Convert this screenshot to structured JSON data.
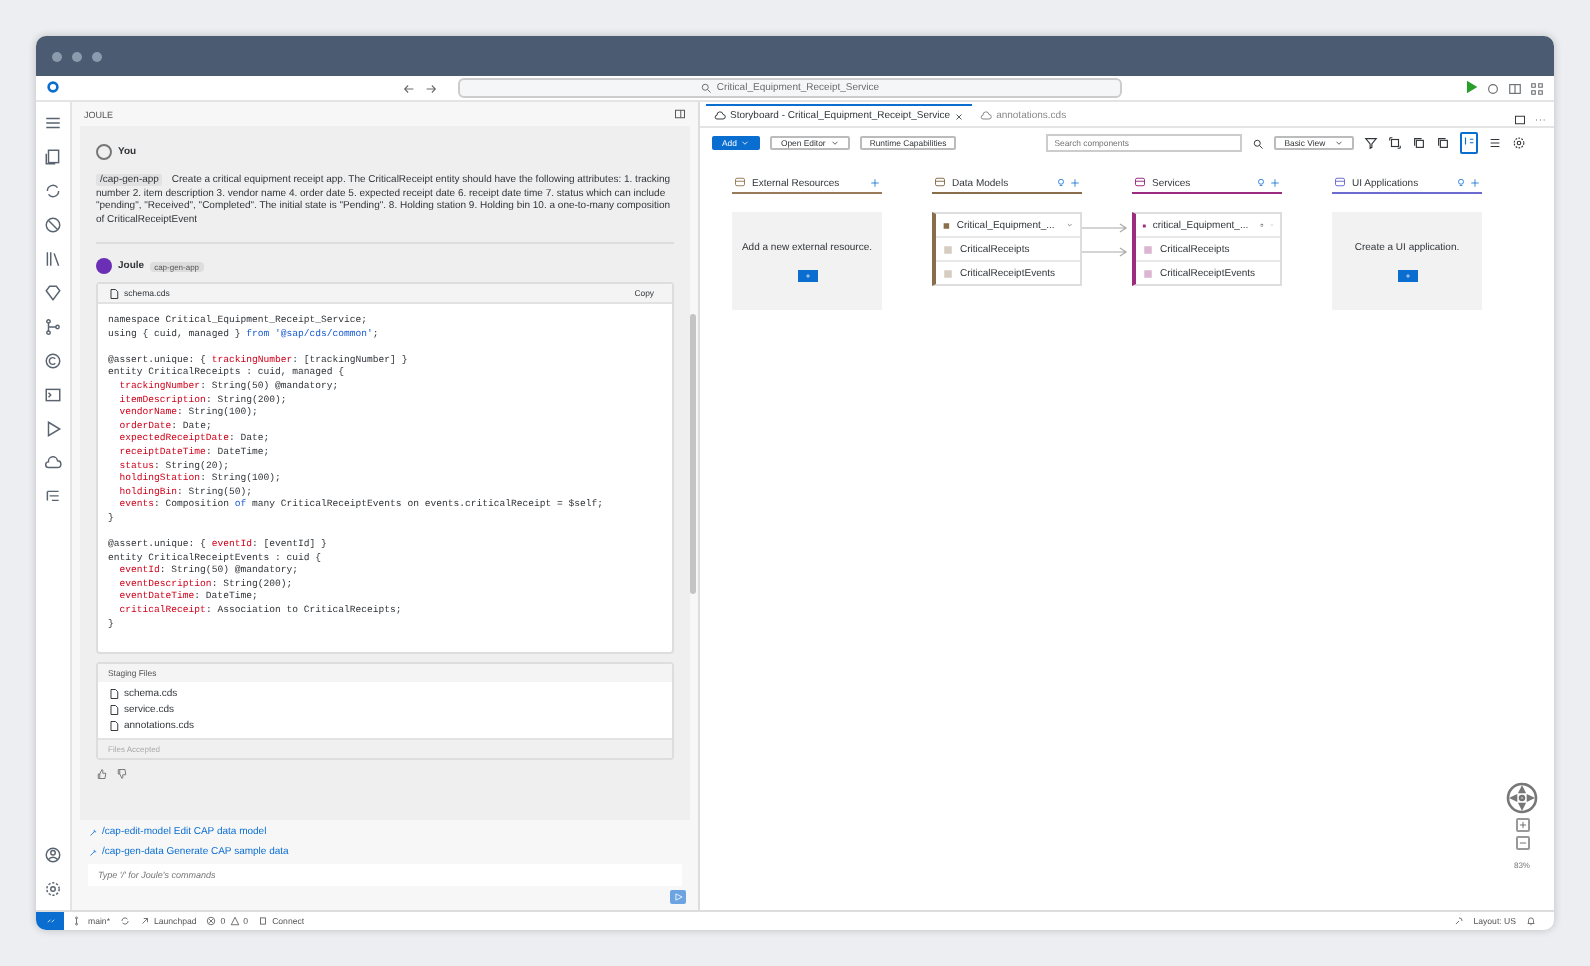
{
  "window": {
    "search": "Critical_Equipment_Receipt_Service"
  },
  "panel": {
    "title": "JOULE"
  },
  "user_message": {
    "name": "You",
    "command": "/cap-gen-app",
    "text": "Create a critical equipment receipt app. The CriticalReceipt entity should have the following attributes: 1. tracking number 2. item description 3. vendor name 4. order date 5. expected receipt date 6. receipt date time 7. status which can include \"pending\", \"Received\", \"Completed\". The initial state is \"Pending\". 8. Holding station 9. Holding bin 10. a one-to-many composition of CriticalReceiptEvent"
  },
  "reply": {
    "name": "Joule",
    "badge": "cap-gen-app",
    "file": "schema.cds",
    "copy": "Copy",
    "code": [
      {
        "indent": false,
        "gap_before": false,
        "parts": [
          {
            "kind": "plain",
            "text": "namespace Critical_Equipment_Receipt_Service;"
          }
        ]
      },
      {
        "indent": false,
        "gap_before": false,
        "parts": [
          {
            "kind": "plain",
            "text": "using { cuid, managed }"
          },
          {
            "kind": "kw",
            "text": "from"
          },
          {
            "kind": "str",
            "text": "'@sap/cds/common'"
          },
          {
            "kind": "punct",
            "text": ";"
          }
        ]
      },
      {
        "indent": false,
        "gap_before": true,
        "parts": [
          {
            "kind": "plain",
            "text": "@assert.unique: {"
          },
          {
            "kind": "key",
            "text": "trackingNumber"
          },
          {
            "kind": "punct",
            "text": ": [trackingNumber] }"
          }
        ]
      },
      {
        "indent": false,
        "gap_before": false,
        "parts": [
          {
            "kind": "plain",
            "text": "entity CriticalReceipts : cuid, managed {"
          }
        ]
      },
      {
        "indent": true,
        "gap_before": false,
        "parts": [
          {
            "kind": "key",
            "text": "trackingNumber"
          },
          {
            "kind": "punct",
            "text": ": String(50) @mandatory;"
          }
        ]
      },
      {
        "indent": true,
        "gap_before": false,
        "parts": [
          {
            "kind": "key",
            "text": "itemDescription"
          },
          {
            "kind": "punct",
            "text": ": String(200);"
          }
        ]
      },
      {
        "indent": true,
        "gap_before": false,
        "parts": [
          {
            "kind": "key",
            "text": "vendorName"
          },
          {
            "kind": "punct",
            "text": ": String(100);"
          }
        ]
      },
      {
        "indent": true,
        "gap_before": false,
        "parts": [
          {
            "kind": "key",
            "text": "orderDate"
          },
          {
            "kind": "punct",
            "text": ": Date;"
          }
        ]
      },
      {
        "indent": true,
        "gap_before": false,
        "parts": [
          {
            "kind": "key",
            "text": "expectedReceiptDate"
          },
          {
            "kind": "punct",
            "text": ": Date;"
          }
        ]
      },
      {
        "indent": true,
        "gap_before": false,
        "parts": [
          {
            "kind": "key",
            "text": "receiptDateTime"
          },
          {
            "kind": "punct",
            "text": ": DateTime;"
          }
        ]
      },
      {
        "indent": true,
        "gap_before": false,
        "parts": [
          {
            "kind": "key",
            "text": "status"
          },
          {
            "kind": "punct",
            "text": ": String(20);"
          }
        ]
      },
      {
        "indent": true,
        "gap_before": false,
        "parts": [
          {
            "kind": "key",
            "text": "holdingStation"
          },
          {
            "kind": "punct",
            "text": ": String(100);"
          }
        ]
      },
      {
        "indent": true,
        "gap_before": false,
        "parts": [
          {
            "kind": "key",
            "text": "holdingBin"
          },
          {
            "kind": "punct",
            "text": ": String(50);"
          }
        ]
      },
      {
        "indent": true,
        "gap_before": false,
        "parts": [
          {
            "kind": "key",
            "text": "events"
          },
          {
            "kind": "punct",
            "text": ": Composition"
          },
          {
            "kind": "kw",
            "text": "of"
          },
          {
            "kind": "plain",
            "text": "many CriticalReceiptEvents on events.criticalReceipt = $self;"
          }
        ]
      },
      {
        "indent": false,
        "gap_before": false,
        "parts": [
          {
            "kind": "plain",
            "text": "}"
          }
        ]
      },
      {
        "indent": false,
        "gap_before": true,
        "parts": [
          {
            "kind": "plain",
            "text": "@assert.unique: {"
          },
          {
            "kind": "key",
            "text": "eventId"
          },
          {
            "kind": "punct",
            "text": ": [eventId] }"
          }
        ]
      },
      {
        "indent": false,
        "gap_before": false,
        "parts": [
          {
            "kind": "plain",
            "text": "entity CriticalReceiptEvents : cuid {"
          }
        ]
      },
      {
        "indent": true,
        "gap_before": false,
        "parts": [
          {
            "kind": "key",
            "text": "eventId"
          },
          {
            "kind": "punct",
            "text": ": String(50) @mandatory;"
          }
        ]
      },
      {
        "indent": true,
        "gap_before": false,
        "parts": [
          {
            "kind": "key",
            "text": "eventDescription"
          },
          {
            "kind": "punct",
            "text": ": String(200);"
          }
        ]
      },
      {
        "indent": true,
        "gap_before": false,
        "parts": [
          {
            "kind": "key",
            "text": "eventDateTime"
          },
          {
            "kind": "punct",
            "text": ": DateTime;"
          }
        ]
      },
      {
        "indent": true,
        "gap_before": false,
        "parts": [
          {
            "kind": "key",
            "text": "criticalReceipt"
          },
          {
            "kind": "punct",
            "text": ": Association to CriticalReceipts;"
          }
        ]
      },
      {
        "indent": false,
        "gap_before": false,
        "parts": [
          {
            "kind": "plain",
            "text": "}"
          }
        ]
      }
    ],
    "staging_title": "Staging Files",
    "staging_files": [
      "schema.cds",
      "service.cds",
      "annotations.cds"
    ],
    "status": "Files Accepted"
  },
  "suggestions": [
    {
      "command": "/cap-edit-model",
      "text": "Edit CAP data model"
    },
    {
      "command": "/cap-gen-data",
      "text": "Generate CAP sample data"
    }
  ],
  "input": {
    "placeholder": "Type '/' for Joule's commands"
  },
  "tabs": [
    {
      "label": "Storyboard - Critical_Equipment_Receipt_Service",
      "selected": true
    },
    {
      "label": "annotations.cds",
      "selected": false
    }
  ],
  "toolbar": {
    "add": "Add",
    "open_editor": "Open Editor",
    "runtime": "Runtime Capabilities",
    "search_placeholder": "Search components",
    "view": "Basic View"
  },
  "columns": [
    {
      "title": "External Resources",
      "color": "#9a7a58",
      "kind": "empty",
      "text": "Add a new external resource."
    },
    {
      "title": "Data Models",
      "color": "#8a6d4b",
      "kind": "entities",
      "header": "Critical_Equipment_...",
      "items": [
        "CriticalReceipts",
        "CriticalReceiptEvents"
      ]
    },
    {
      "title": "Services",
      "color": "#9b2c7f",
      "kind": "entities",
      "header": "critical_Equipment_...",
      "items": [
        "CriticalReceipts",
        "CriticalReceiptEvents"
      ]
    },
    {
      "title": "UI Applications",
      "color": "#6b6bd0",
      "kind": "empty",
      "text": "Create a UI application."
    }
  ],
  "zoom": "83%",
  "status_bar": {
    "branch": "main*",
    "launchpad": "Launchpad",
    "errors": "0",
    "warnings": "0",
    "connect": "Connect",
    "layout": "Layout: US"
  }
}
